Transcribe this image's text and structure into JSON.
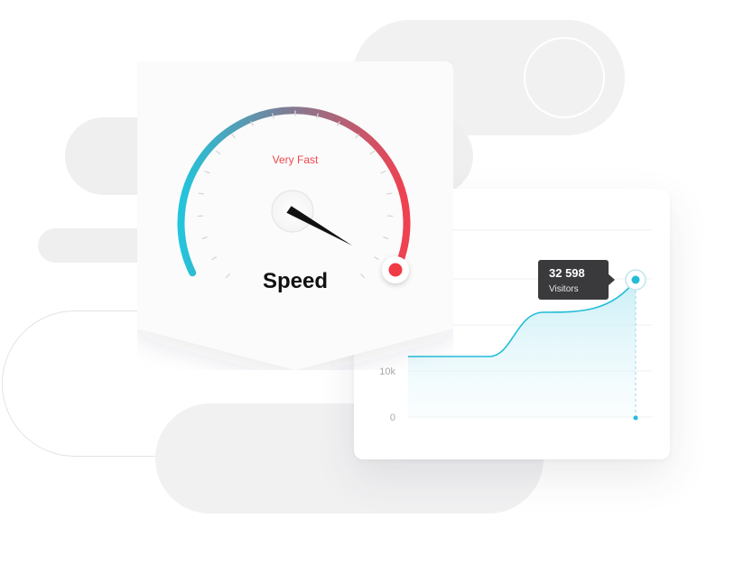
{
  "gauge": {
    "status_text": "Very Fast",
    "title": "Speed",
    "colors": {
      "start": "#22c5dc",
      "end": "#f04150",
      "needle": "#111111",
      "indicator": "#ef3b43"
    }
  },
  "chart_data": {
    "type": "area",
    "y_ticks": [
      "10k",
      "0"
    ],
    "tooltip": {
      "value": "32 598",
      "label": "Visitors"
    },
    "line_color": "#22bcd8"
  }
}
